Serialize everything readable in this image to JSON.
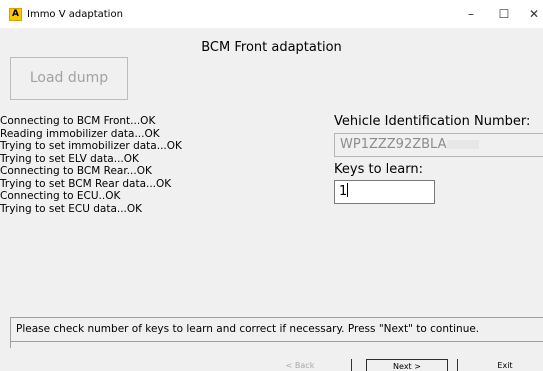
{
  "window": {
    "icon_letter": "A",
    "title": "Immo V adaptation",
    "minimize": "–",
    "maximize": "☐",
    "close": "✕"
  },
  "heading": "BCM Front adaptation",
  "load_button": "Load dump",
  "log_lines": [
    "Connecting to BCM Front...OK",
    "Reading immobilizer data...OK",
    "Trying to set immobilizer data...OK",
    "Trying to set ELV data...OK",
    "Connecting to BCM Rear...OK",
    "Trying to set BCM Rear data...OK",
    "Connecting to ECU..OK",
    "Trying to set ECU data...OK"
  ],
  "vin": {
    "label": "Vehicle Identification Number:",
    "value": "WP1ZZZ92ZBLA"
  },
  "keys": {
    "label": "Keys to learn:",
    "value": "1"
  },
  "status": "Please check number of keys to learn and correct if necessary. Press \"Next\" to continue.",
  "buttons": {
    "back": "< Back",
    "next": "Next >",
    "exit": "Exit"
  }
}
